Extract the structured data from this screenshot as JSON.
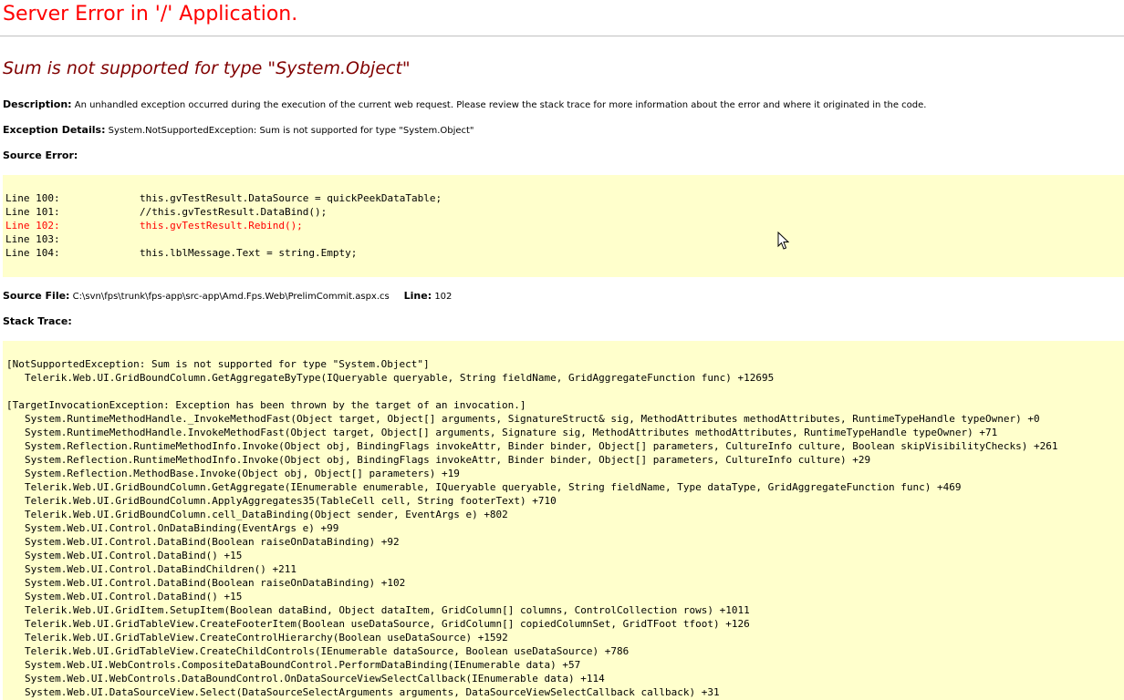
{
  "header": {
    "title": "Server Error in '/' Application.",
    "error_message": "Sum is not supported for type \"System.Object\""
  },
  "description": {
    "label": "Description:",
    "text": "An unhandled exception occurred during the execution of the current web request. Please review the stack trace for more information about the error and where it originated in the code."
  },
  "exception_details": {
    "label": "Exception Details:",
    "text": "System.NotSupportedException: Sum is not supported for type \"System.Object\""
  },
  "source_error": {
    "label": "Source Error:",
    "lines": [
      {
        "number": "Line 100:",
        "code": "this.gvTestResult.DataSource = quickPeekDataTable;",
        "error": false
      },
      {
        "number": "Line 101:",
        "code": "//this.gvTestResult.DataBind();",
        "error": false
      },
      {
        "number": "Line 102:",
        "code": "this.gvTestResult.Rebind();",
        "error": true
      },
      {
        "number": "Line 103:",
        "code": "",
        "error": false
      },
      {
        "number": "Line 104:",
        "code": "this.lblMessage.Text = string.Empty;",
        "error": false
      }
    ]
  },
  "source_file": {
    "label": "Source File:",
    "path": "C:\\svn\\fps\\trunk\\fps-app\\src-app\\Amd.Fps.Web\\PrelimCommit.aspx.cs",
    "line_label": "Line:",
    "line_value": "102"
  },
  "stack_trace": {
    "label": "Stack Trace:",
    "blocks": [
      {
        "header": "[NotSupportedException: Sum is not supported for type \"System.Object\"]",
        "frames": [
          "Telerik.Web.UI.GridBoundColumn.GetAggregateByType(IQueryable queryable, String fieldName, GridAggregateFunction func) +12695"
        ]
      },
      {
        "header": "[TargetInvocationException: Exception has been thrown by the target of an invocation.]",
        "frames": [
          "System.RuntimeMethodHandle._InvokeMethodFast(Object target, Object[] arguments, SignatureStruct& sig, MethodAttributes methodAttributes, RuntimeTypeHandle typeOwner) +0",
          "System.RuntimeMethodHandle.InvokeMethodFast(Object target, Object[] arguments, Signature sig, MethodAttributes methodAttributes, RuntimeTypeHandle typeOwner) +71",
          "System.Reflection.RuntimeMethodInfo.Invoke(Object obj, BindingFlags invokeAttr, Binder binder, Object[] parameters, CultureInfo culture, Boolean skipVisibilityChecks) +261",
          "System.Reflection.RuntimeMethodInfo.Invoke(Object obj, BindingFlags invokeAttr, Binder binder, Object[] parameters, CultureInfo culture) +29",
          "System.Reflection.MethodBase.Invoke(Object obj, Object[] parameters) +19",
          "Telerik.Web.UI.GridBoundColumn.GetAggregate(IEnumerable enumerable, IQueryable queryable, String fieldName, Type dataType, GridAggregateFunction func) +469",
          "Telerik.Web.UI.GridBoundColumn.ApplyAggregates35(TableCell cell, String footerText) +710",
          "Telerik.Web.UI.GridBoundColumn.cell_DataBinding(Object sender, EventArgs e) +802",
          "System.Web.UI.Control.OnDataBinding(EventArgs e) +99",
          "System.Web.UI.Control.DataBind(Boolean raiseOnDataBinding) +92",
          "System.Web.UI.Control.DataBind() +15",
          "System.Web.UI.Control.DataBindChildren() +211",
          "System.Web.UI.Control.DataBind(Boolean raiseOnDataBinding) +102",
          "System.Web.UI.Control.DataBind() +15",
          "Telerik.Web.UI.GridItem.SetupItem(Boolean dataBind, Object dataItem, GridColumn[] columns, ControlCollection rows) +1011",
          "Telerik.Web.UI.GridTableView.CreateFooterItem(Boolean useDataSource, GridColumn[] copiedColumnSet, GridTFoot tfoot) +126",
          "Telerik.Web.UI.GridTableView.CreateControlHierarchy(Boolean useDataSource) +1592",
          "Telerik.Web.UI.GridTableView.CreateChildControls(IEnumerable dataSource, Boolean useDataSource) +786",
          "System.Web.UI.WebControls.CompositeDataBoundControl.PerformDataBinding(IEnumerable data) +57",
          "System.Web.UI.WebControls.DataBoundControl.OnDataSourceViewSelectCallback(IEnumerable data) +114",
          "System.Web.UI.DataSourceView.Select(DataSourceSelectArguments arguments, DataSourceViewSelectCallback callback) +31"
        ]
      }
    ]
  },
  "colors": {
    "title": "#ff0000",
    "error_message": "#800000",
    "code_background": "#ffffcc",
    "error_line": "#ff0000"
  },
  "icons": {
    "cursor": "mouse-pointer-icon"
  }
}
